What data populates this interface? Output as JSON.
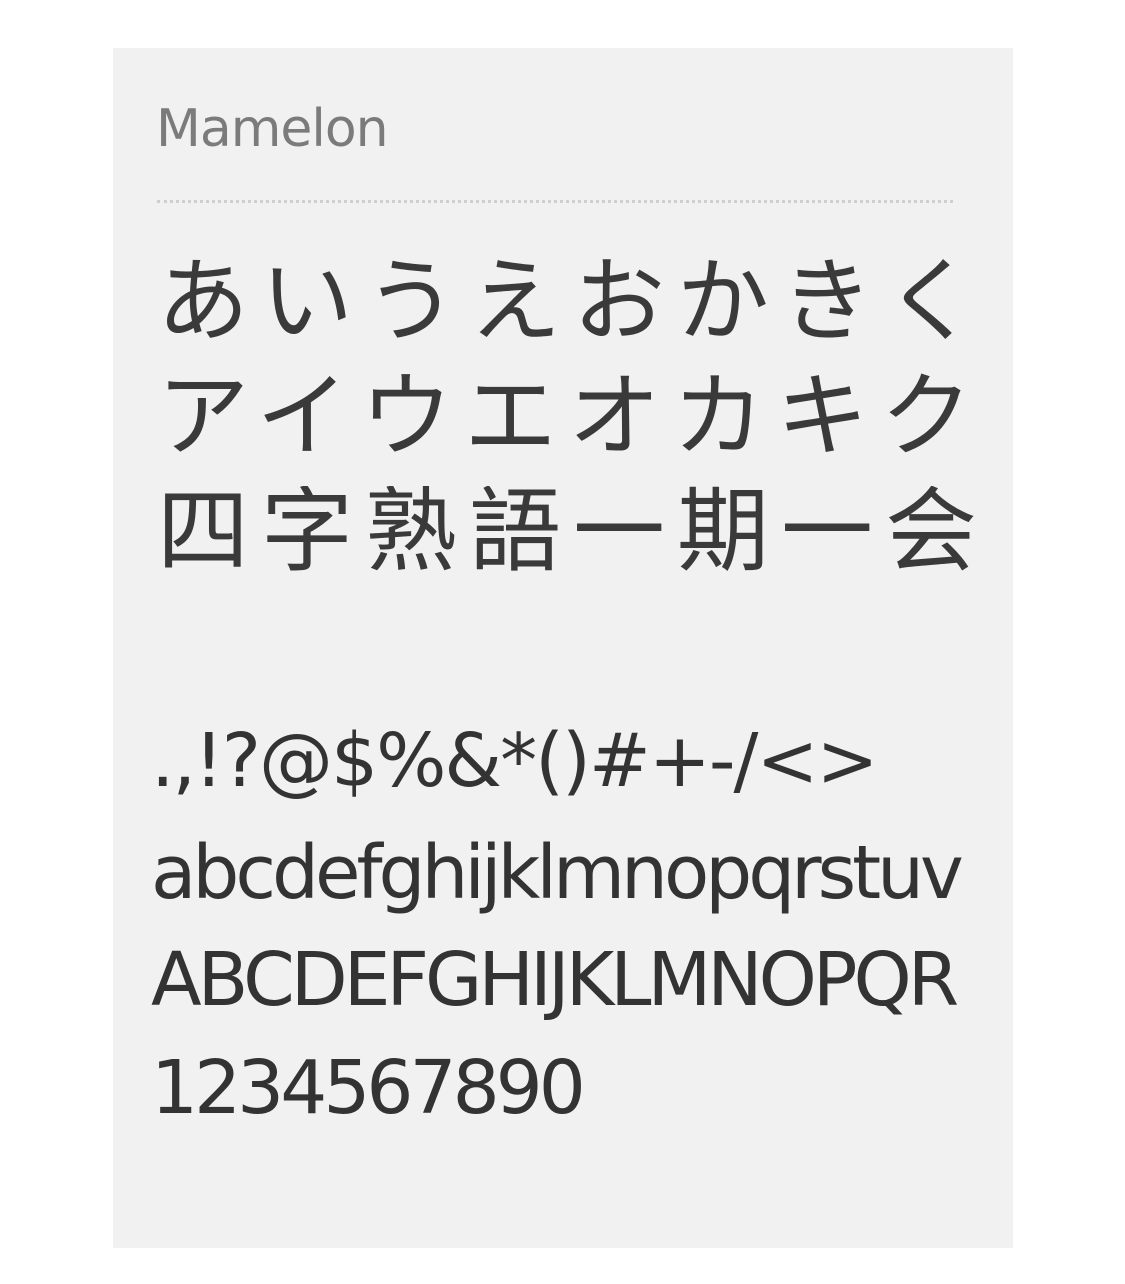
{
  "font_name": "Mamelon",
  "samples": {
    "hiragana": "あいうえおかきく",
    "katakana": "アイウエオカキク",
    "kanji": "四字熟語一期一会",
    "symbols": ".,!?@$%&*()#+-/<>",
    "lowercase": "abcdefghijklmnopqrstuv",
    "uppercase": "ABCDEFGHIJKLMNOPQR",
    "digits": "1234567890"
  },
  "colors": {
    "card_background": "#f1f1f1",
    "title_text": "#7b7b7b",
    "sample_text": "#3a3a3a",
    "divider": "#cfcfcf"
  }
}
